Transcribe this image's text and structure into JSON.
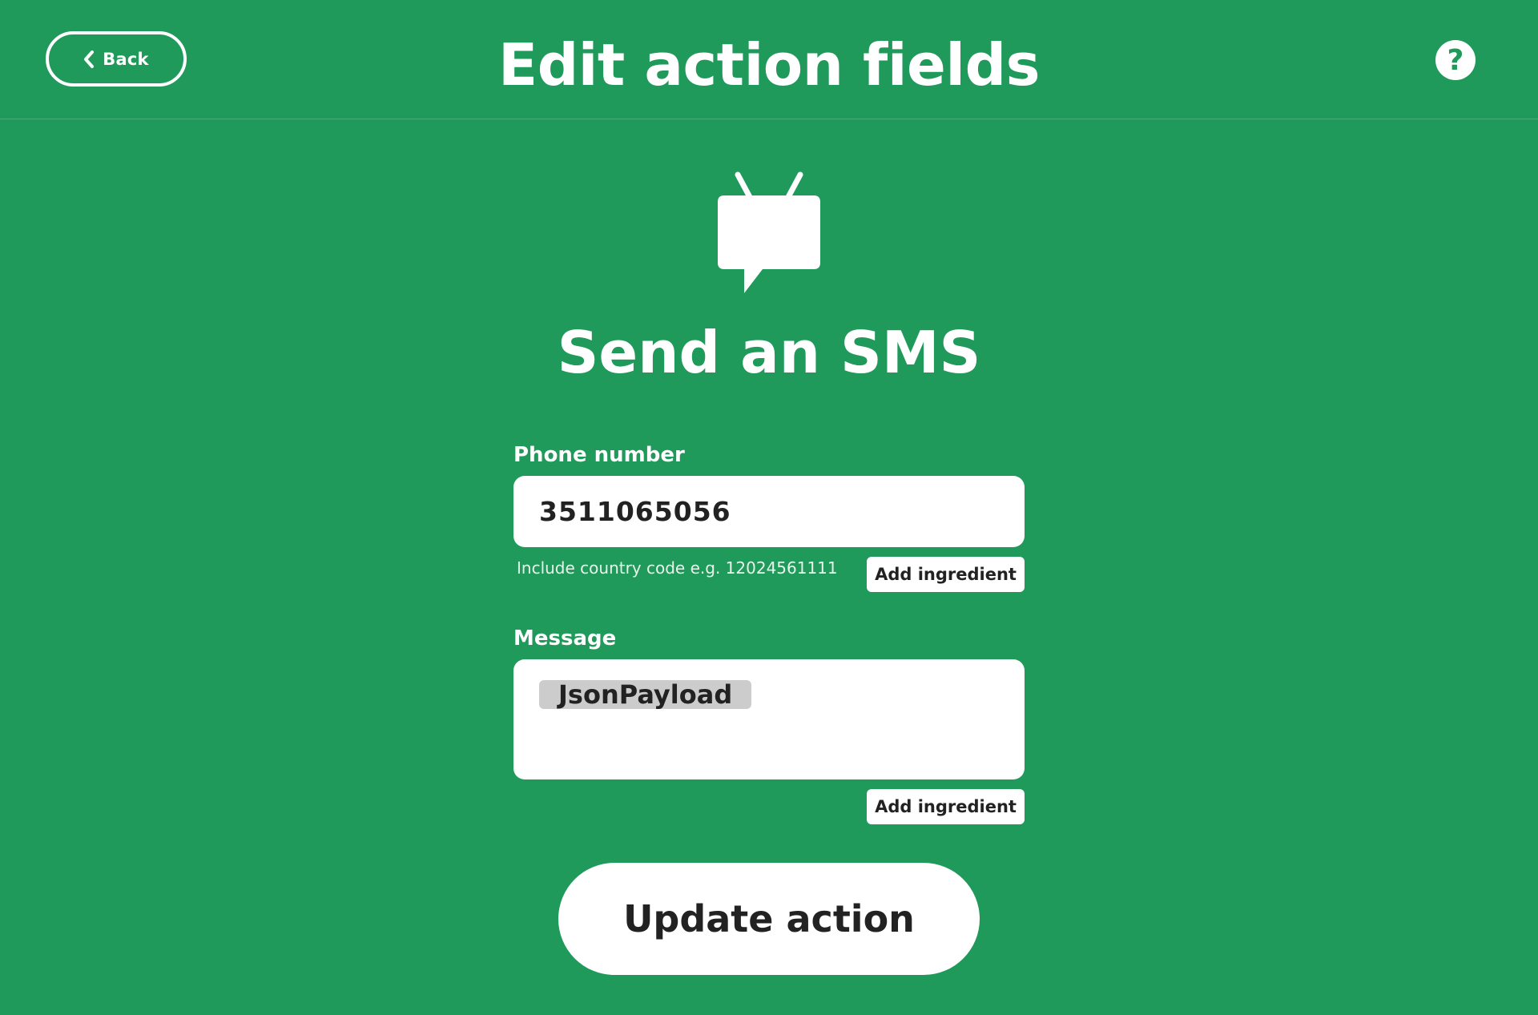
{
  "header": {
    "back_label": "Back",
    "title": "Edit action fields",
    "help_symbol": "?"
  },
  "service": {
    "icon": "sms-message-icon",
    "action_title": "Send an SMS"
  },
  "form": {
    "phone": {
      "label": "Phone number",
      "value": "3511065056",
      "help_text": "Include country code e.g. 12024561111",
      "ingredient_button": "Add ingredient"
    },
    "message": {
      "label": "Message",
      "ingredient_value": "JsonPayload",
      "ingredient_button": "Add ingredient"
    }
  },
  "update_button_label": "Update action",
  "colors": {
    "background": "#1f9a5a",
    "surface": "#ffffff",
    "text_dark": "#222222",
    "ingredient_pill": "#cccccc"
  }
}
